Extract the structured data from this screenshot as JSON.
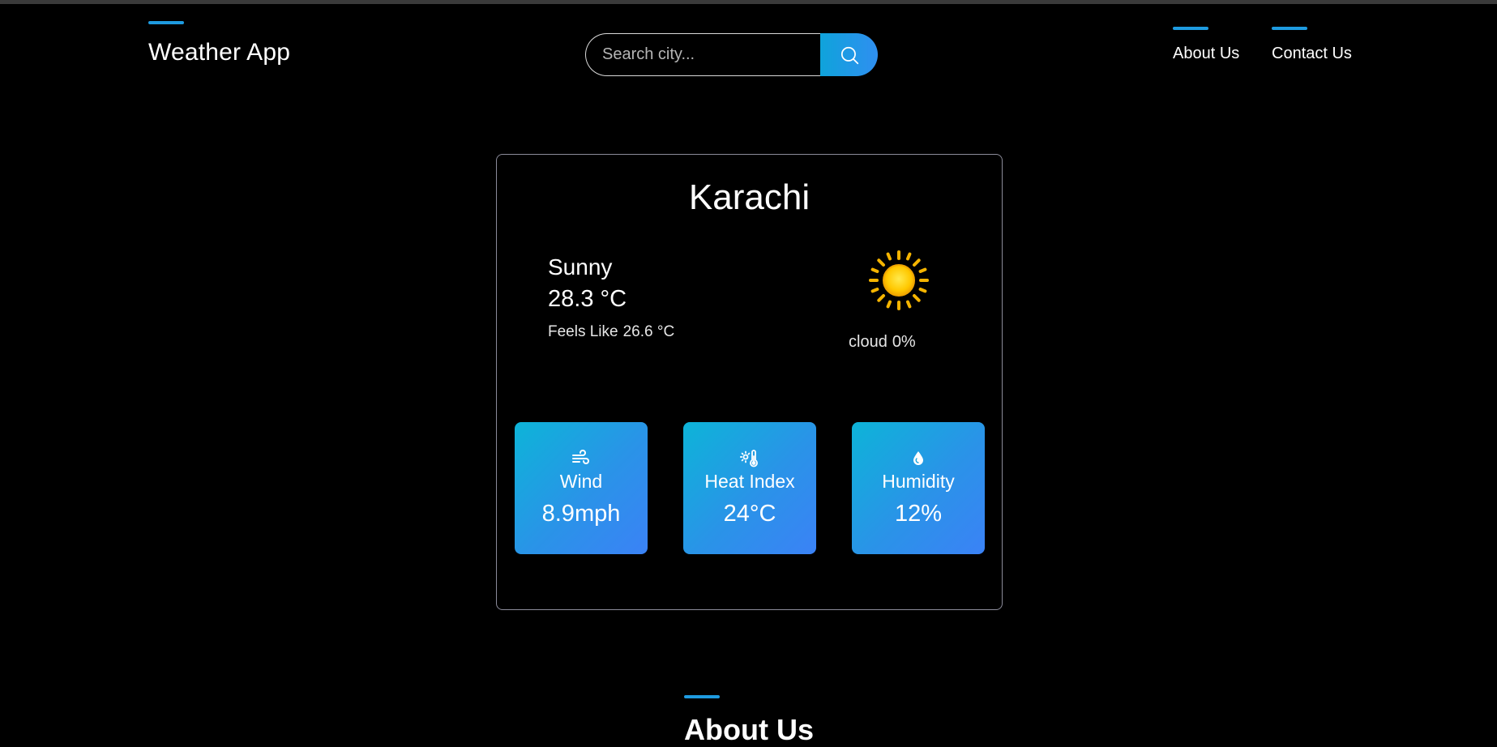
{
  "header": {
    "brand": "Weather App",
    "search": {
      "placeholder": "Search city...",
      "icon": "search-icon"
    },
    "nav": [
      {
        "label": "About Us"
      },
      {
        "label": "Contact Us"
      }
    ]
  },
  "weather": {
    "city": "Karachi",
    "condition": "Sunny",
    "temperature": "28.3 °C",
    "feels_like_label": "Feels Like",
    "feels_like_value": "26.6 °C",
    "condition_icon": "sun-icon",
    "cloud_label": "cloud",
    "cloud_value": "0%",
    "stats": [
      {
        "icon": "wind-icon",
        "label": "Wind",
        "value": "8.9mph"
      },
      {
        "icon": "thermometer-sun-icon",
        "label": "Heat Index",
        "value": "24°C"
      },
      {
        "icon": "droplet-icon",
        "label": "Humidity",
        "value": "12%"
      }
    ]
  },
  "about": {
    "title": "About Us"
  },
  "colors": {
    "accent": "#1e9be0",
    "card_gradient_start": "#0db4d8",
    "card_gradient_end": "#3b82f6"
  }
}
